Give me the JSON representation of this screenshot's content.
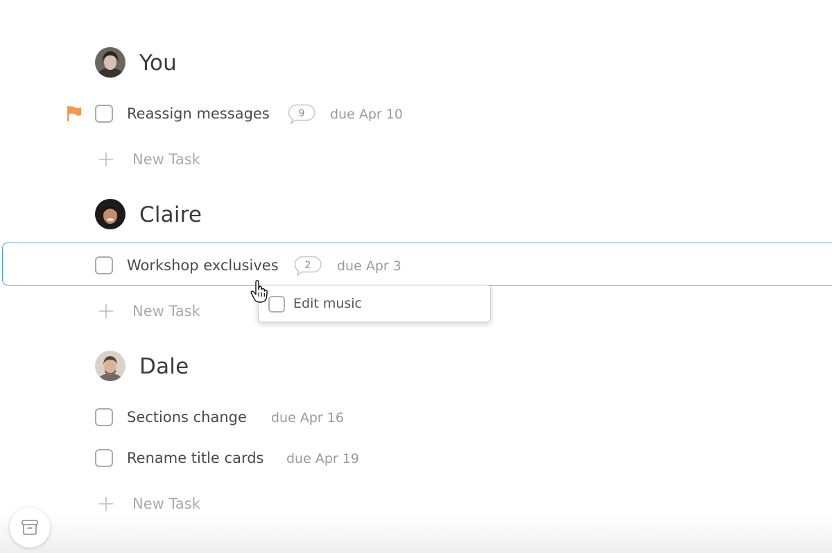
{
  "sections": [
    {
      "person": "You",
      "avatar": "avatar-you",
      "tasks": [
        {
          "title": "Reassign messages",
          "comments": "9",
          "due": "due Apr 10",
          "flagged": true
        }
      ],
      "new_task_label": "New Task"
    },
    {
      "person": "Claire",
      "avatar": "avatar-claire",
      "tasks": [
        {
          "title": "Workshop exclusives",
          "comments": "2",
          "due": "due Apr 3",
          "selected": true
        }
      ],
      "new_task_label": "New Task"
    },
    {
      "person": "Dale",
      "avatar": "avatar-dale",
      "tasks": [
        {
          "title": "Sections change",
          "due": "due Apr 16"
        },
        {
          "title": "Rename title cards",
          "due": "due Apr 19"
        }
      ],
      "new_task_label": "New Task"
    }
  ],
  "popup": {
    "item_label": "Edit music"
  },
  "colors": {
    "flag": "#f39a4e",
    "selection_border": "#4aa3dc",
    "checkbox_border": "#aaaaaa"
  },
  "icons": {
    "flag": "flag-icon",
    "plus": "plus-icon",
    "comment": "comment-bubble-icon",
    "archive": "archive-box-icon",
    "cursor": "hand-pointer-icon"
  }
}
